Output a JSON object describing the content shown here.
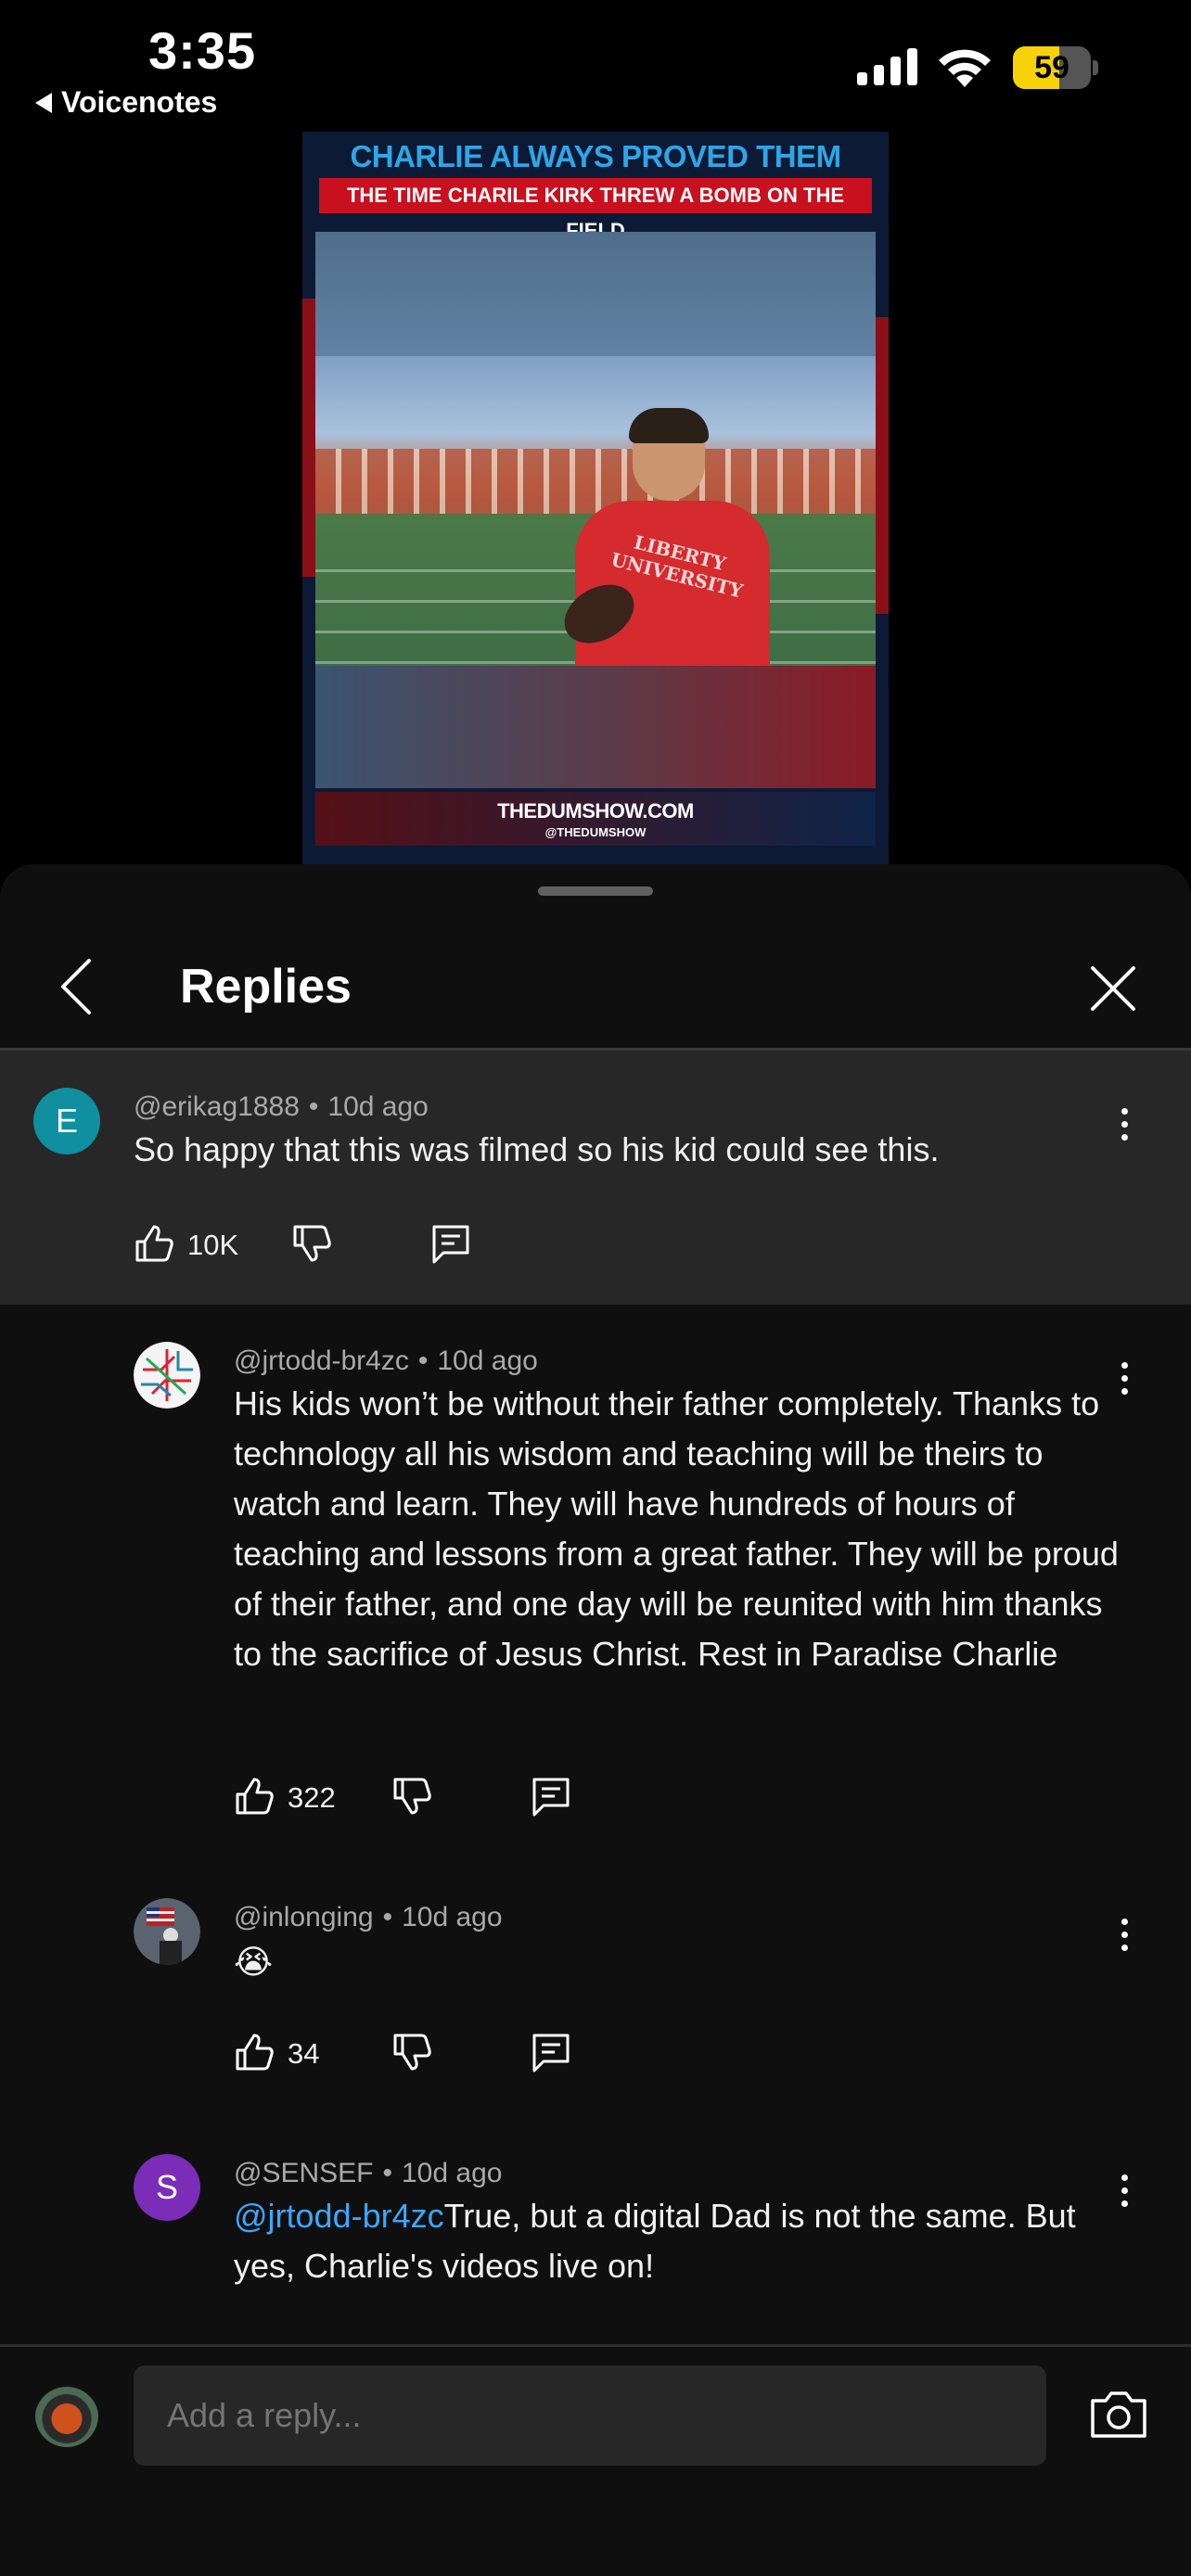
{
  "status_bar": {
    "time": "3:35",
    "back_app": "Voicenotes",
    "battery": "59",
    "battery_level": 0.59
  },
  "video": {
    "headline": "CHARLIE ALWAYS PROVED THEM WRONG",
    "subheadline": "THE TIME CHARILE KIRK THREW A BOMB ON THE FIELD",
    "shirt_text": "LIBERTY UNIVERSITY",
    "site": "THEDUMSHOW.COM",
    "handle": "@THEDUMSHOW"
  },
  "sheet": {
    "title": "Replies"
  },
  "comments": [
    {
      "avatar_letter": "E",
      "avatar_color": "#0f8fa0",
      "author": "@erikag1888",
      "age": "10d ago",
      "text": "So happy that this was filmed so his kid could see this.",
      "likes": "10K",
      "highlighted": true
    },
    {
      "avatar_icon": "subway-map-avatar",
      "author": "@jrtodd-br4zc",
      "age": "10d ago",
      "text": "His kids won’t be without their father completely. Thanks to technology all his wisdom and teaching will be theirs to watch and learn. They will have hundreds of hours of teaching and lessons from a great father. They will be proud of their father, and one day will be reunited with him thanks to the sacrifice of Jesus Christ. Rest in Paradise Charlie",
      "likes": "322"
    },
    {
      "avatar_icon": "flag-photo-avatar",
      "author": "@inlonging",
      "age": "10d ago",
      "text": "😭",
      "likes": "34"
    },
    {
      "avatar_letter": "S",
      "avatar_color": "#7b2db8",
      "author": "@SENSEF",
      "age": "10d ago",
      "mention": "@jrtodd-br4zc",
      "text": "True, but a digital Dad is not the same. But yes, Charlie's videos live on!"
    }
  ],
  "reply_box": {
    "placeholder": "Add a reply..."
  },
  "icons": {
    "back": "chevron-left-icon",
    "close": "close-icon",
    "more": "more-vertical-icon",
    "like": "thumbs-up-icon",
    "dislike": "thumbs-down-icon",
    "reply": "reply-comment-icon",
    "camera": "camera-icon"
  }
}
